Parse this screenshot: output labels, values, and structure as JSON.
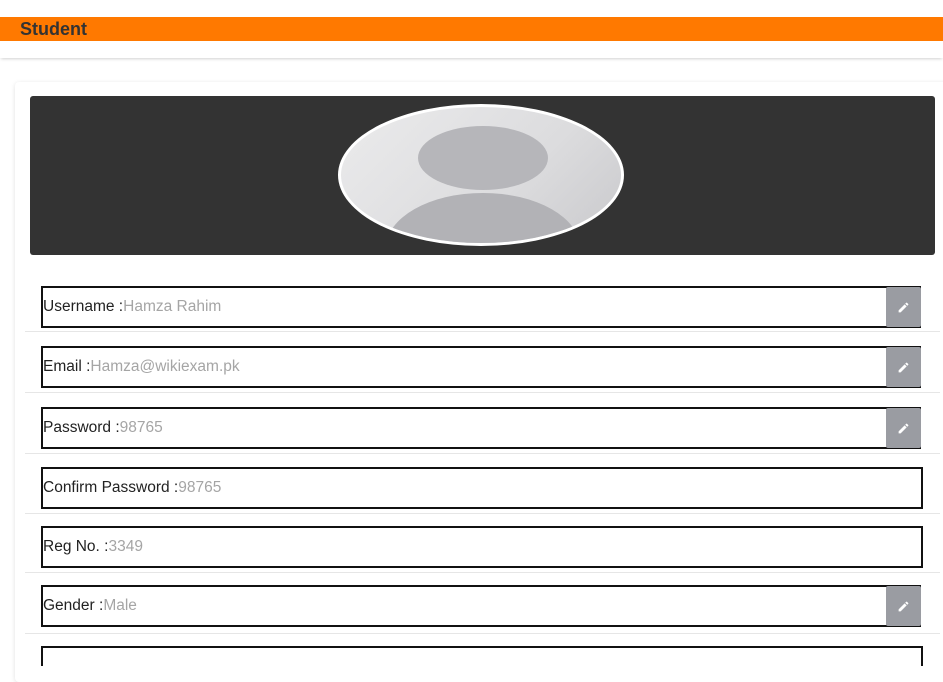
{
  "header": {
    "title": "Student",
    "accent_color": "#ff7900"
  },
  "profile": {
    "avatar_icon": "default-user-avatar"
  },
  "fields": [
    {
      "label": "Username :",
      "value": "Hamza Rahim",
      "editable": true
    },
    {
      "label": "Email :",
      "value": "Hamza@wikiexam.pk",
      "editable": true
    },
    {
      "label": "Password :",
      "value": "98765",
      "editable": true
    },
    {
      "label": "Confirm Password :",
      "value": "98765",
      "editable": false
    },
    {
      "label": "Reg No. :",
      "value": "3349",
      "editable": false
    },
    {
      "label": "Gender :",
      "value": "Male",
      "editable": true
    }
  ],
  "icons": {
    "edit": "pencil-icon"
  }
}
